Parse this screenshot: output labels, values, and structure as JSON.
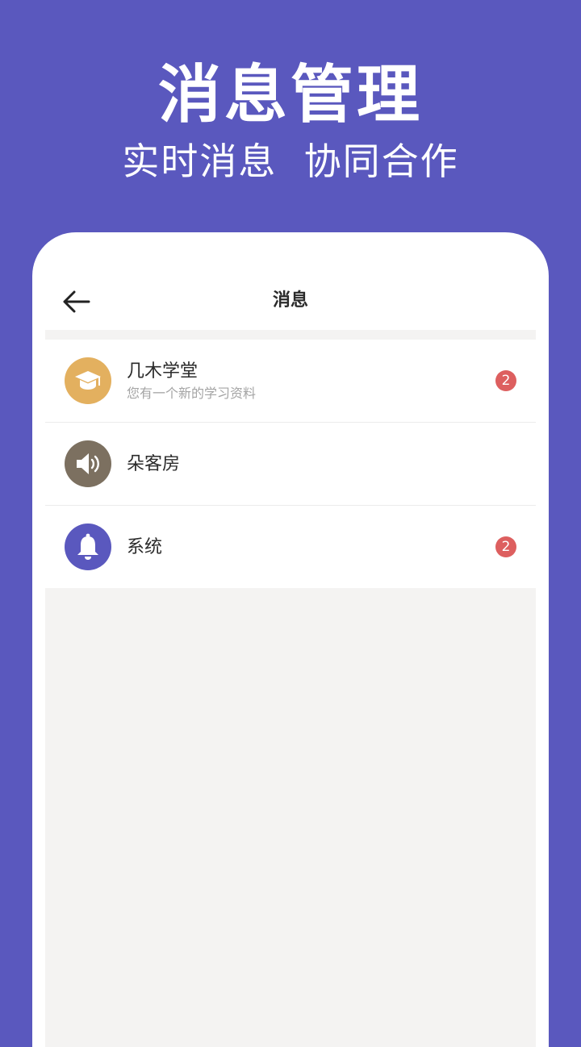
{
  "hero": {
    "title": "消息管理",
    "subtitle": "实时消息  协同合作"
  },
  "nav": {
    "title": "消息",
    "back_icon": "arrow-left-icon"
  },
  "messages": [
    {
      "name": "几木学堂",
      "preview": "您有一个新的学习资料",
      "badge": "2",
      "icon": "graduation-cap-icon",
      "color": "#e3b05f"
    },
    {
      "name": "朵客房",
      "preview": "",
      "badge": "",
      "icon": "speaker-icon",
      "color": "#7c7060"
    },
    {
      "name": "系统",
      "preview": "",
      "badge": "2",
      "icon": "bell-icon",
      "color": "#5a58be"
    }
  ],
  "colors": {
    "background": "#5a58be",
    "badge": "#dd5f5f",
    "list_bg": "#f4f3f2"
  }
}
